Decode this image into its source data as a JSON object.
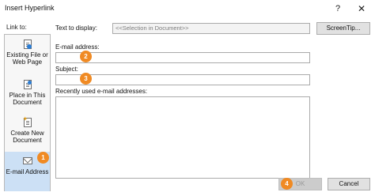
{
  "window": {
    "title": "Insert Hyperlink",
    "help_glyph": "?",
    "close_glyph": "✕"
  },
  "link_to": {
    "label": "Link to:",
    "items": [
      {
        "label": "Existing File or Web Page",
        "icon": "existing-file-icon"
      },
      {
        "label": "Place in This Document",
        "icon": "place-in-document-icon"
      },
      {
        "label": "Create New Document",
        "icon": "create-new-document-icon"
      },
      {
        "label": "E-mail Address",
        "icon": "email-address-icon",
        "selected": true
      }
    ]
  },
  "form": {
    "text_to_display_label": "Text to display:",
    "text_to_display_value": "<<Selection in Document>>",
    "screentip_label": "ScreenTip...",
    "email_label": "E-mail address:",
    "email_value": "",
    "subject_label": "Subject:",
    "subject_value": "",
    "recent_label": "Recently used e-mail addresses:"
  },
  "buttons": {
    "ok": "OK",
    "cancel": "Cancel"
  },
  "badges": [
    "1",
    "2",
    "3",
    "4"
  ],
  "colors": {
    "badge": "#f08a23",
    "selected_item": "#cce0f5"
  }
}
